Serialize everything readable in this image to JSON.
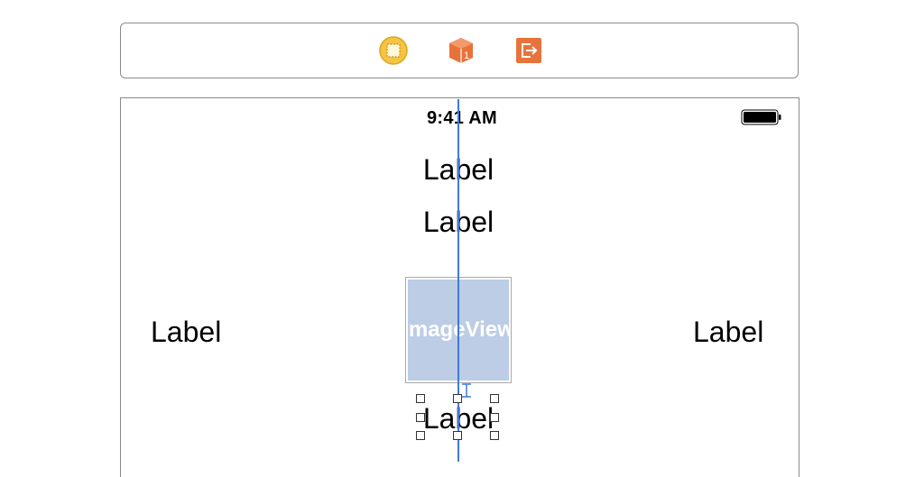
{
  "scene_dock": {
    "icons": [
      "view-controller-icon",
      "first-responder-icon",
      "exit-icon"
    ],
    "first_responder_badge": "1",
    "colors": {
      "view_controller": "#f5c542",
      "first_responder": "#e8733a",
      "exit": "#e8733a"
    }
  },
  "status_bar": {
    "time": "9:41 AM"
  },
  "labels": {
    "top_1": "Label",
    "top_2": "Label",
    "left": "Label",
    "right": "Label",
    "bottom": "Label"
  },
  "image_view": {
    "text": "ImageView"
  },
  "colors": {
    "guide": "#3f7ad8",
    "image_view_fill": "#bccde5"
  }
}
